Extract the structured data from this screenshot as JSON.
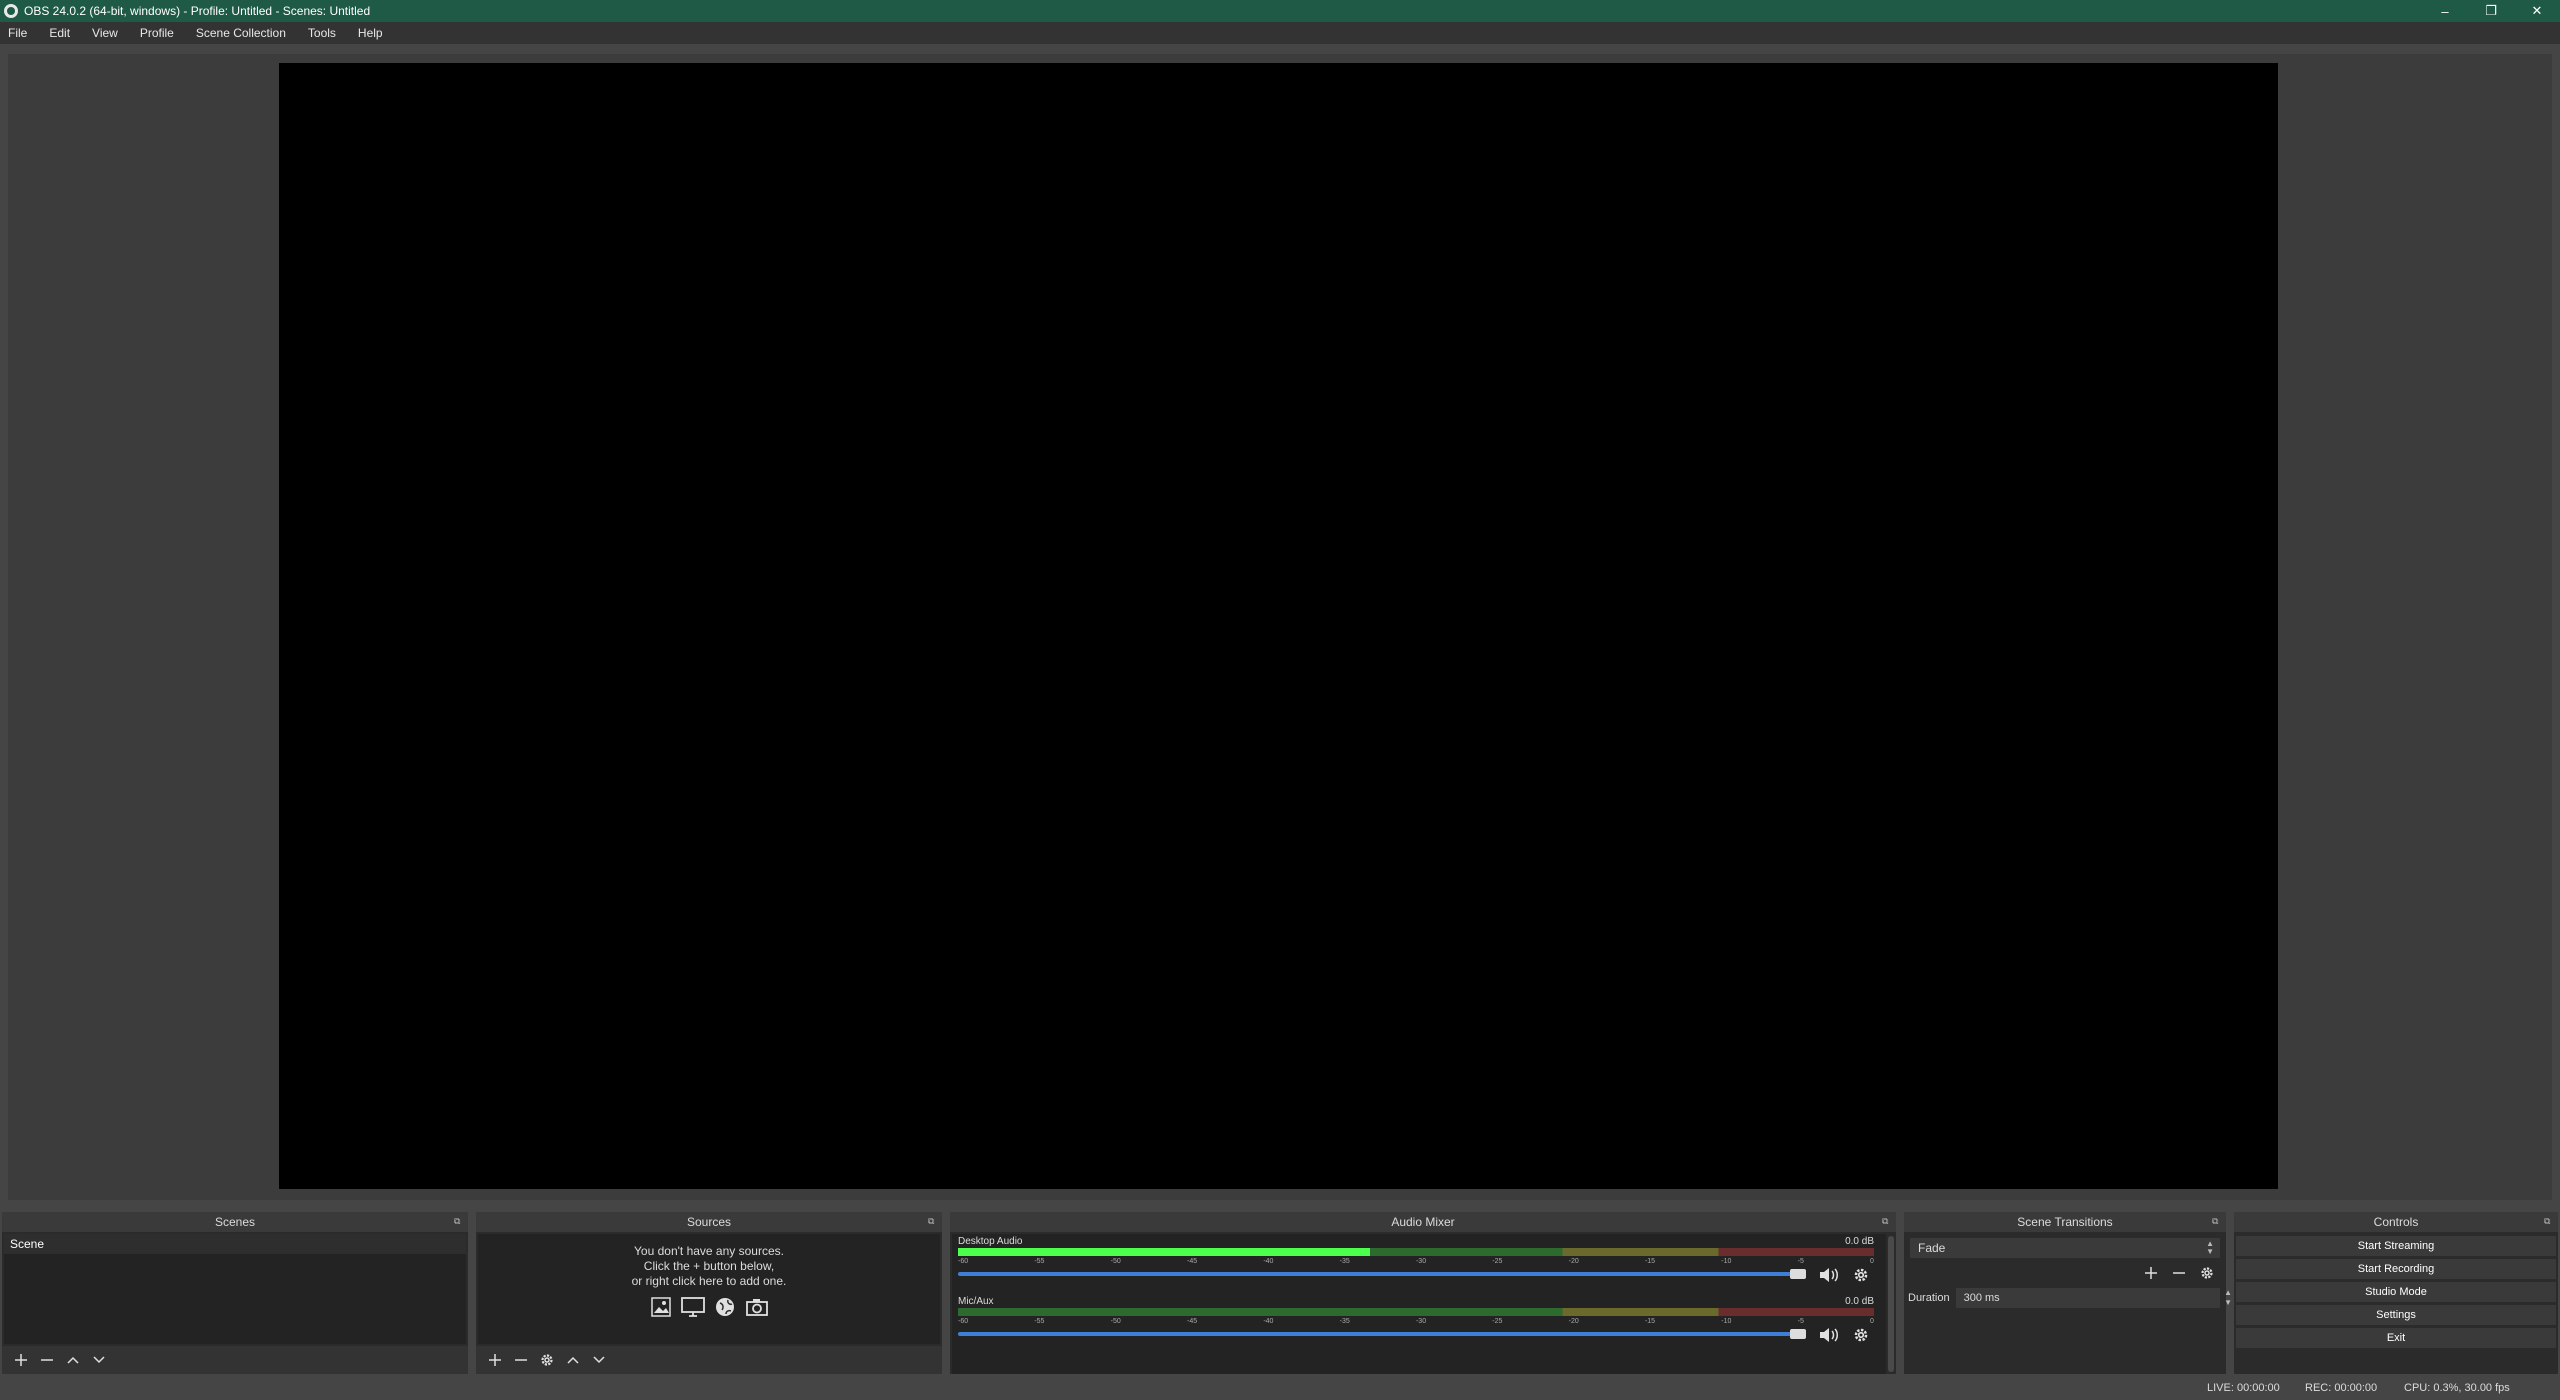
{
  "window": {
    "title": "OBS 24.0.2 (64-bit, windows) - Profile: Untitled - Scenes: Untitled",
    "controls": [
      "–",
      "❐",
      "✕"
    ]
  },
  "menu": [
    "File",
    "Edit",
    "View",
    "Profile",
    "Scene Collection",
    "Tools",
    "Help"
  ],
  "scenes": {
    "title": "Scenes",
    "items": [
      "Scene"
    ]
  },
  "sources": {
    "title": "Sources",
    "empty_line1": "You don't have any sources.",
    "empty_line2": "Click the + button below,",
    "empty_line3": "or right click here to add one."
  },
  "mixer": {
    "title": "Audio Mixer",
    "ticks": [
      "-60",
      "-55",
      "-50",
      "-45",
      "-40",
      "-35",
      "-30",
      "-25",
      "-20",
      "-15",
      "-10",
      "-5",
      "0"
    ],
    "channels": [
      {
        "name": "Desktop Audio",
        "db": "0.0 dB",
        "level": 0.45,
        "volume": 1.0
      },
      {
        "name": "Mic/Aux",
        "db": "0.0 dB",
        "level": 0.0,
        "volume": 1.0
      }
    ]
  },
  "transitions": {
    "title": "Scene Transitions",
    "selected": "Fade",
    "duration_label": "Duration",
    "duration_value": "300 ms"
  },
  "controls": {
    "title": "Controls",
    "buttons": [
      "Start Streaming",
      "Start Recording",
      "Studio Mode",
      "Settings",
      "Exit"
    ]
  },
  "status": {
    "live": "LIVE: 00:00:00",
    "rec": "REC: 00:00:00",
    "cpu": "CPU: 0.3%, 30.00 fps"
  },
  "colors": {
    "titlebar": "#1f5a46",
    "volume_slider": "#3d80d6",
    "meter_green": "#4cff4c"
  }
}
